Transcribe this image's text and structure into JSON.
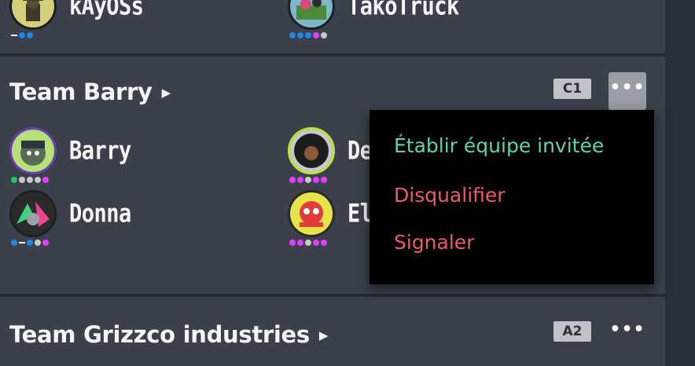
{
  "teams": [
    {
      "name": "",
      "players": [
        {
          "name": "kAyOSs",
          "dots": [
            "#f4f4f4:dash",
            "#1e88e5",
            "#1e88e5"
          ]
        },
        {
          "name": "TakoTruck",
          "dots": [
            "#1e88e5",
            "#1e88e5",
            "#1e88e5",
            "#e040fb",
            "#c8c8c8"
          ]
        }
      ]
    },
    {
      "name": "Team Barry",
      "seed": "C1",
      "players": [
        {
          "name": "Barry",
          "dots": [
            "#22c55e",
            "#c8c8c8",
            "#c8c8c8",
            "#c8c8c8",
            "#e040fb"
          ]
        },
        {
          "name": "De",
          "dots": [
            "#e040fb",
            "#e040fb",
            "#c8c8c8",
            "#e040fb",
            "#e040fb"
          ]
        },
        {
          "name": "Donna",
          "dots": [
            "#1e88e5",
            "#f4f4f4:dash",
            "#1e88e5",
            "#c8c8c8",
            "#e040fb"
          ]
        },
        {
          "name": "Eli",
          "dots": [
            "#e040fb",
            "#e040fb",
            "#c8c8c8",
            "#e040fb",
            "#e040fb"
          ]
        }
      ]
    },
    {
      "name": "Team Grizzco industries",
      "seed": "A2"
    }
  ],
  "arrow_glyph": "▶",
  "more_glyph": "•••",
  "menu": {
    "items": [
      {
        "label": "Établir équipe invitée",
        "color": "#5ed3b0"
      },
      {
        "label": "Disqualifier",
        "color": "#f05a66"
      },
      {
        "label": "Signaler",
        "color": "#f05a66"
      }
    ]
  }
}
